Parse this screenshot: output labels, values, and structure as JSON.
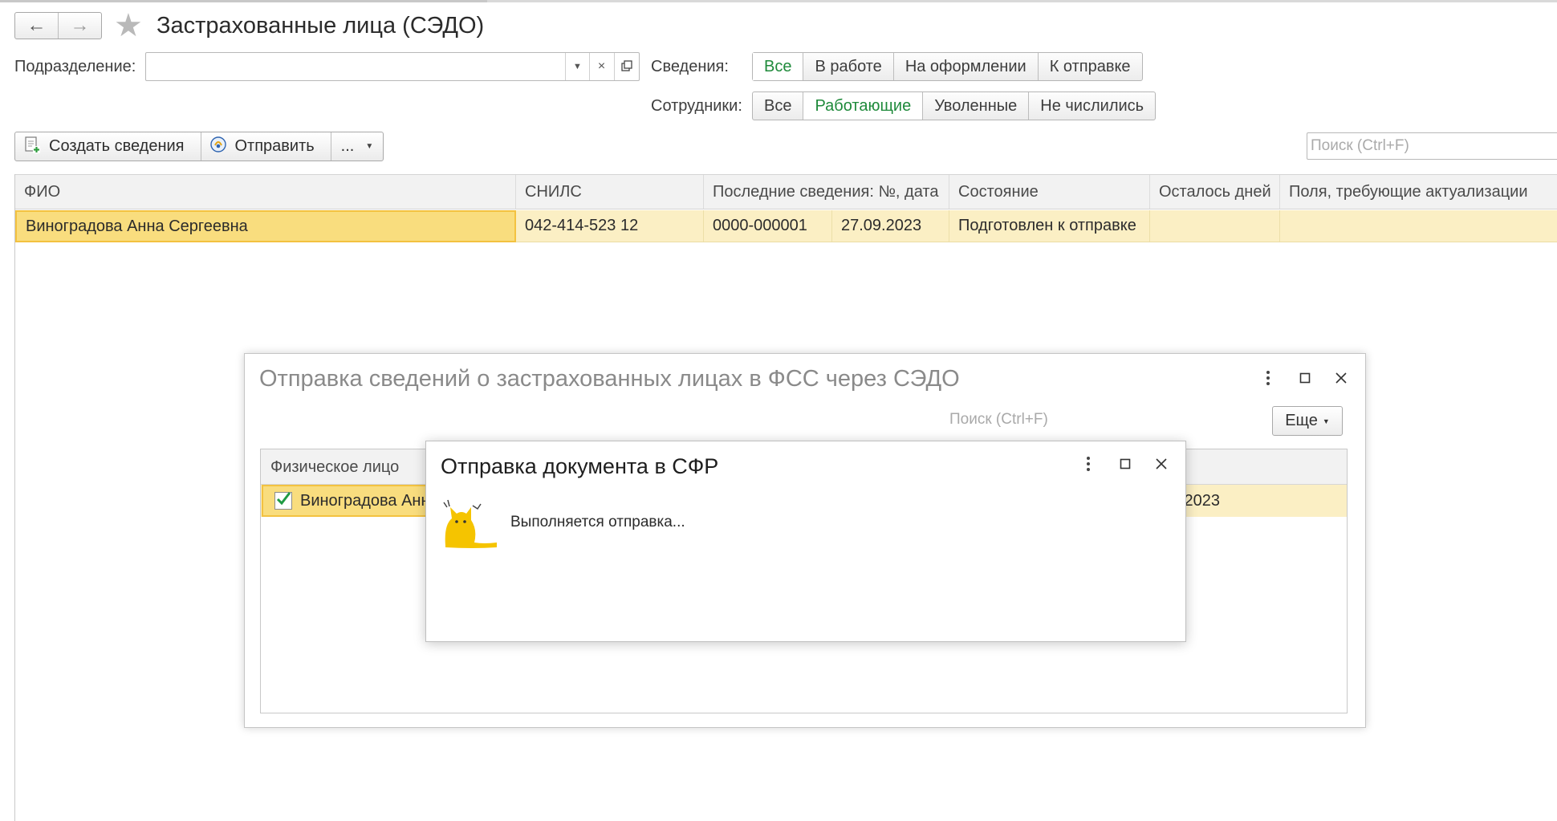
{
  "window": {
    "title": "Застрахованные лица (СЭДО)",
    "nav": {
      "back_icon": "arrow-left-icon",
      "forward_icon": "arrow-right-icon",
      "favorite_icon": "star-icon"
    }
  },
  "filters": {
    "division_label": "Подразделение:",
    "division_value": "",
    "info_label": "Сведения:",
    "info_options": [
      "Все",
      "В работе",
      "На оформлении",
      "К отправке"
    ],
    "info_selected": "Все",
    "employees_label": "Сотрудники:",
    "employees_options": [
      "Все",
      "Работающие",
      "Уволенные",
      "Не числились"
    ],
    "employees_selected": "Работающие"
  },
  "toolbar": {
    "create_label": "Создать сведения",
    "send_label": "Отправить",
    "more_label": "...",
    "search_placeholder": "Поиск (Ctrl+F)"
  },
  "grid": {
    "columns": [
      "ФИО",
      "СНИЛС",
      "Последние сведения: №, дата",
      "Состояние",
      "Осталось дней",
      "Поля, требующие актуализации"
    ],
    "rows": [
      {
        "fio": "Виноградова Анна Сергеевна",
        "snils": "042-414-523 12",
        "doc_number": "0000-000001",
        "doc_date": "27.09.2023",
        "state": "Подготовлен к отправке",
        "days_left": "",
        "fields_to_update": ""
      }
    ]
  },
  "dialog_send": {
    "title": "Отправка сведений о застрахованных лицах в ФСС через СЭДО",
    "search_placeholder": "Поиск (Ctrl+F)",
    "more_label": "Еще",
    "column_person": "Физическое лицо",
    "row_person": "Виноградова Анн",
    "row_date_fragment": ".2023",
    "row_checked": true
  },
  "dialog_progress": {
    "title": "Отправка документа в СФР",
    "message": "Выполняется отправка..."
  },
  "colors": {
    "accent_green": "#1f8a3b",
    "row_highlight": "#fbefc4",
    "selected_cell": "#f9dd7e",
    "selected_border": "#f3c240",
    "cat_yellow": "#f5c400"
  }
}
